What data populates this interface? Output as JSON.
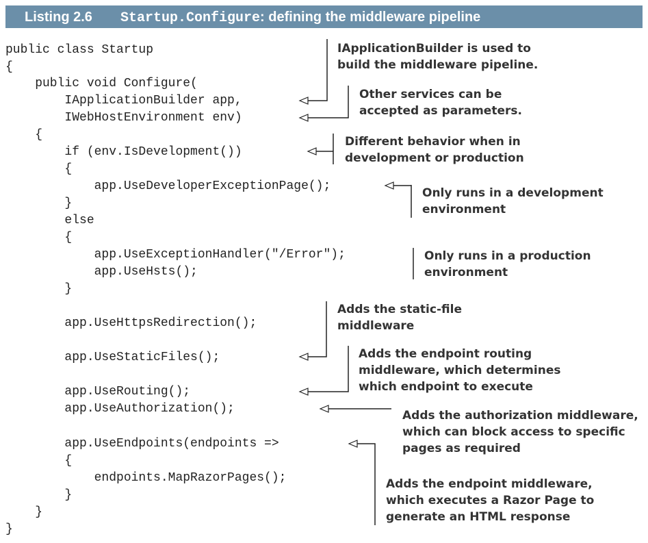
{
  "listing": {
    "label": "Listing 2.6",
    "title_code": "Startup.Configure",
    "title_text": ": defining the middleware pipeline"
  },
  "code_lines": [
    "public class Startup",
    "{",
    "    public void Configure(",
    "        IApplicationBuilder app,",
    "        IWebHostEnvironment env)",
    "    {",
    "        if (env.IsDevelopment())",
    "        {",
    "            app.UseDeveloperExceptionPage();",
    "        }",
    "        else",
    "        {",
    "            app.UseExceptionHandler(\"/Error\");",
    "            app.UseHsts();",
    "        }",
    "        app.UseHttpsRedirection();",
    "        app.UseStaticFiles();",
    "        app.UseRouting();",
    "        app.UseAuthorization();",
    "        app.UseEndpoints(endpoints =>",
    "        {",
    "            endpoints.MapRazorPages();",
    "        }",
    "    }",
    "}"
  ],
  "annotations": [
    "IApplicationBuilder is used to\nbuild the middleware pipeline.",
    "Other services can be\naccepted as parameters.",
    "Different behavior when in\ndevelopment or production",
    "Only runs in a development\nenvironment",
    "Only runs in a production\nenvironment",
    "Adds the static-file\nmiddleware",
    "Adds the endpoint routing\nmiddleware, which determines\nwhich endpoint to execute",
    "Adds the authorization middleware,\nwhich can block access to specific\npages as required",
    "Adds the endpoint middleware,\nwhich executes a Razor Page to\ngenerate an HTML response"
  ]
}
